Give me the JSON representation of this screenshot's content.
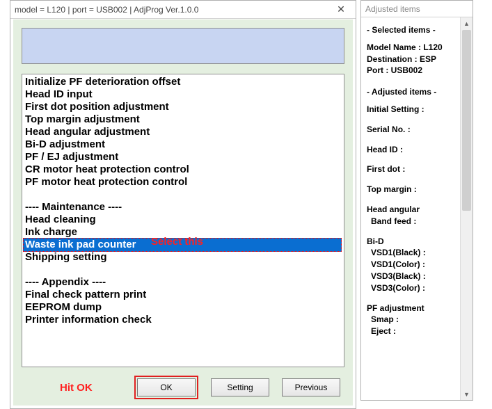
{
  "window": {
    "title": "model = L120 | port = USB002 | AdjProg Ver.1.0.0",
    "close_icon": "✕"
  },
  "listbox": {
    "items": [
      "Initialize PF deterioration offset",
      "Head ID input",
      "First dot position adjustment",
      "Top margin adjustment",
      "Head angular adjustment",
      "Bi-D adjustment",
      "PF / EJ adjustment",
      "CR motor heat protection control",
      "PF motor heat protection control",
      "",
      "---- Maintenance ----",
      "Head cleaning",
      "Ink charge",
      "Waste ink pad counter",
      "Shipping setting",
      "",
      "---- Appendix ----",
      "Final check pattern print",
      "EEPROM dump",
      "Printer information check"
    ],
    "selected_index": 13
  },
  "buttons": {
    "ok": "OK",
    "setting": "Setting",
    "previous": "Previous"
  },
  "annotations": {
    "select_this": "Select this",
    "hit_ok": "Hit OK"
  },
  "side": {
    "title": "Adjusted items",
    "selected_header": "- Selected items -",
    "model_name": "Model Name : L120",
    "destination": "Destination : ESP",
    "port": "Port : USB002",
    "adjusted_header": "- Adjusted items -",
    "initial_setting": "Initial Setting :",
    "serial_no": "Serial No. :",
    "head_id": "Head ID :",
    "first_dot": "First dot :",
    "top_margin": "Top margin :",
    "head_angular": "Head angular",
    "band_feed": "Band feed :",
    "bi_d": "Bi-D",
    "vsd1_black": "VSD1(Black) :",
    "vsd1_color": "VSD1(Color) :",
    "vsd3_black": "VSD3(Black) :",
    "vsd3_color": "VSD3(Color) :",
    "pf_adjustment": "PF adjustment",
    "smap": "Smap :",
    "eject": "Eject :"
  }
}
